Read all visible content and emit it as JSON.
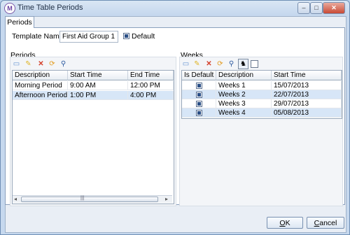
{
  "window": {
    "title": "Time Table Periods",
    "icon_glyph": "M",
    "controls": {
      "minimize": "–",
      "maximize": "□",
      "close": "✕"
    }
  },
  "tabs": [
    {
      "label": "Periods"
    }
  ],
  "template": {
    "name_label": "Template Name",
    "name_value": "First Aid Group 1",
    "default_label": "Default",
    "default_checked": true
  },
  "periods": {
    "title": "Periods",
    "toolbar": [
      "new-icon",
      "edit-icon",
      "delete-icon",
      "refresh-icon",
      "find-icon"
    ],
    "columns": [
      "Description",
      "Start Time",
      "End Time"
    ],
    "rows": [
      {
        "description": "Morning Period",
        "start": "9:00 AM",
        "end": "12:00 PM"
      },
      {
        "description": "Afternoon Period",
        "start": "1:00 PM",
        "end": "4:00 PM"
      }
    ],
    "scroll_grip": "|||"
  },
  "weeks": {
    "title": "Weeks",
    "toolbar": [
      "new-icon",
      "edit-icon",
      "delete-icon",
      "refresh-icon",
      "find-icon",
      "chess-knight-icon",
      "checkbox-icon"
    ],
    "columns": [
      "Is Default",
      "Description",
      "Start Time"
    ],
    "rows": [
      {
        "is_default": true,
        "description": "Weeks 1",
        "start": "15/07/2013"
      },
      {
        "is_default": true,
        "description": "Weeks 2",
        "start": "22/07/2013"
      },
      {
        "is_default": true,
        "description": "Weeks 3",
        "start": "29/07/2013"
      },
      {
        "is_default": true,
        "description": "Weeks 4",
        "start": "05/08/2013"
      }
    ]
  },
  "buttons": {
    "ok_key": "O",
    "ok_rest": "K",
    "cancel_key": "C",
    "cancel_rest": "ancel"
  }
}
